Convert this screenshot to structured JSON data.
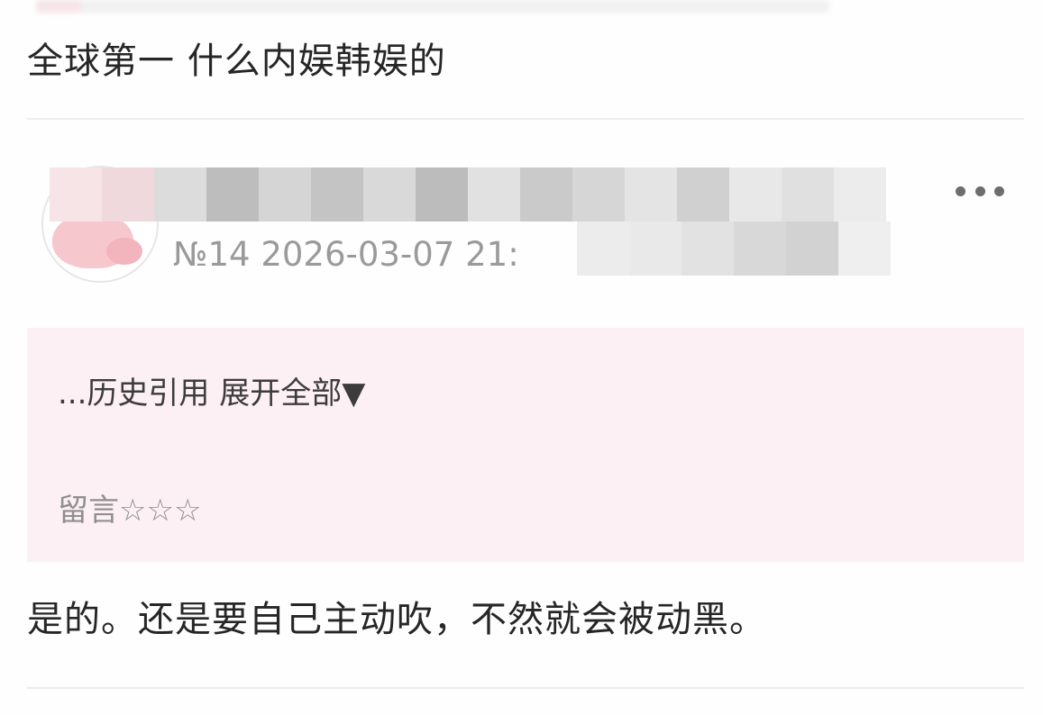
{
  "previous_post": {
    "text": "全球第一 什么内娱韩娱的"
  },
  "reply": {
    "floor_and_time": "№14 2026-03-07 21:",
    "quote": {
      "toggle_label": "...历史引用 展开全部▼",
      "text": "留言☆☆☆"
    },
    "text": "是的。还是要自己主动吹，不然就会被动黑。",
    "more_icon": "more-horizontal-icon"
  },
  "colors": {
    "quote_background": "#fdf0f4",
    "meta_text": "#9a9a9a",
    "avatar_accent": "#f6c7cd"
  }
}
